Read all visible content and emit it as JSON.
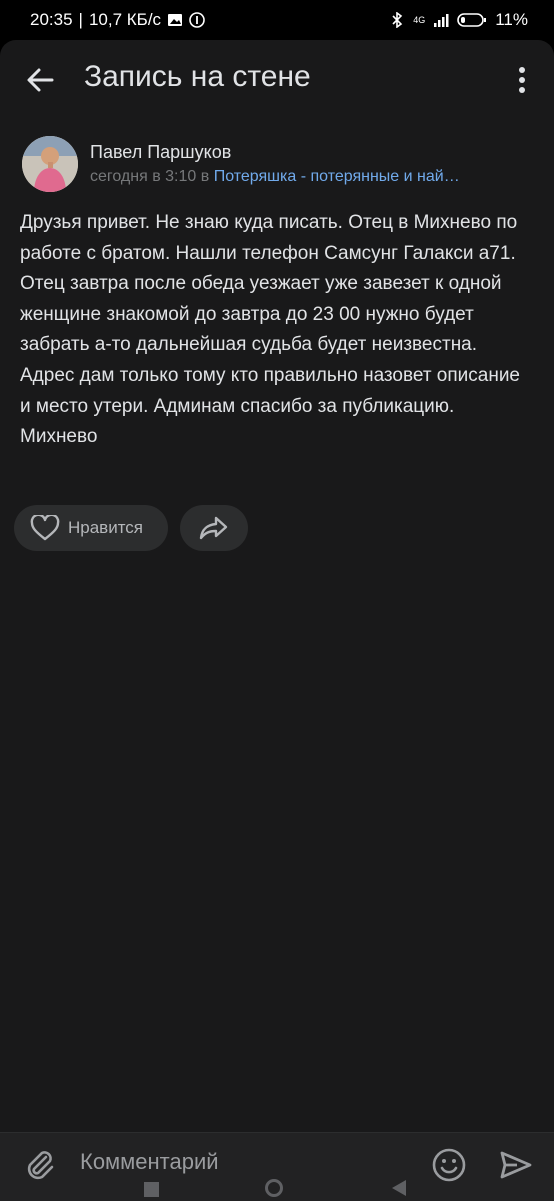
{
  "status_bar": {
    "time": "20:35",
    "speed": "10,7 КБ/с",
    "network": "4G",
    "battery": "11"
  },
  "header": {
    "title": "Запись на стене"
  },
  "post": {
    "author": "Павел Паршуков",
    "time_prefix": "сегодня в 3:10 в",
    "group": "Потеряшка - потерянные и най…",
    "text": "Друзья привет. Не знаю куда писать. Отец в Михнево по работе с братом. Нашли телефон Самсунг Галакси а71. Отец завтра после обеда уезжает уже завезет к одной женщине знакомой до завтра до 23 00 нужно будет забрать а-то дальнейшая судьба будет неизвестна. Адрес дам только тому кто правильно назовет описание и место утери. Админам спасибо за публикацию. Михнево"
  },
  "actions": {
    "like_label": "Нравится"
  },
  "composer": {
    "placeholder": "Комментарий"
  },
  "colors": {
    "background": "#19191a",
    "link": "#71aaeb",
    "pill": "#2c2d2e"
  }
}
